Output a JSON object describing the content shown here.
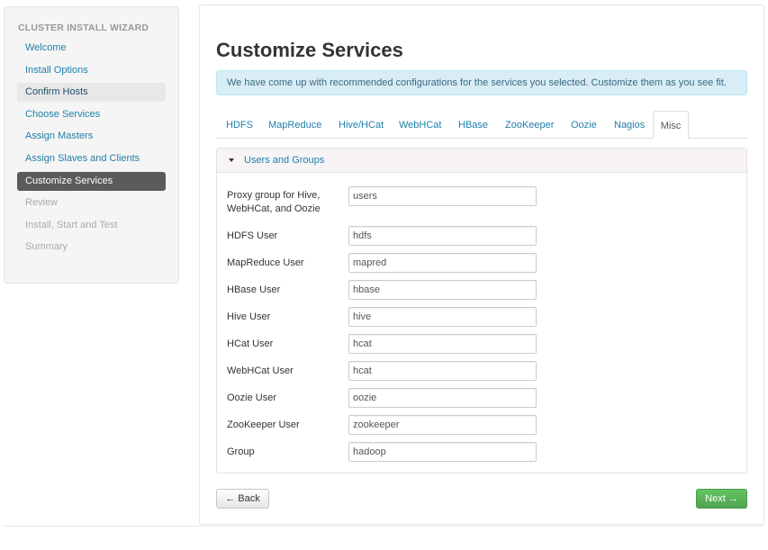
{
  "sidebar": {
    "title": "CLUSTER INSTALL WIZARD",
    "items": [
      {
        "label": "Welcome",
        "state": "done"
      },
      {
        "label": "Install Options",
        "state": "done"
      },
      {
        "label": "Confirm Hosts",
        "state": "visited"
      },
      {
        "label": "Choose Services",
        "state": "done"
      },
      {
        "label": "Assign Masters",
        "state": "done"
      },
      {
        "label": "Assign Slaves and Clients",
        "state": "done"
      },
      {
        "label": "Customize Services",
        "state": "active"
      },
      {
        "label": "Review",
        "state": "disabled"
      },
      {
        "label": "Install, Start and Test",
        "state": "disabled"
      },
      {
        "label": "Summary",
        "state": "disabled"
      }
    ]
  },
  "main": {
    "title": "Customize Services",
    "alert": "We have come up with recommended configurations for the services you selected. Customize them as you see fit.",
    "tabs": [
      "HDFS",
      "MapReduce",
      "Hive/HCat",
      "WebHCat",
      "HBase",
      "ZooKeeper",
      "Oozie",
      "Nagios",
      "Misc"
    ],
    "active_tab": "Misc",
    "section": {
      "title": "Users and Groups",
      "fields": [
        {
          "label": "Proxy group for Hive, WebHCat, and Oozie",
          "value": "users"
        },
        {
          "label": "HDFS User",
          "value": "hdfs"
        },
        {
          "label": "MapReduce User",
          "value": "mapred"
        },
        {
          "label": "HBase User",
          "value": "hbase"
        },
        {
          "label": "Hive User",
          "value": "hive"
        },
        {
          "label": "HCat User",
          "value": "hcat"
        },
        {
          "label": "WebHCat User",
          "value": "hcat"
        },
        {
          "label": "Oozie User",
          "value": "oozie"
        },
        {
          "label": "ZooKeeper User",
          "value": "zookeeper"
        },
        {
          "label": "Group",
          "value": "hadoop"
        }
      ]
    },
    "back_label": "← Back",
    "next_label": "Next →"
  },
  "colors": {
    "link": "#1f7fa9",
    "active_nav": "#5b5b5b",
    "alert_bg": "#d9edf7",
    "next_button": "#5bb75b"
  }
}
